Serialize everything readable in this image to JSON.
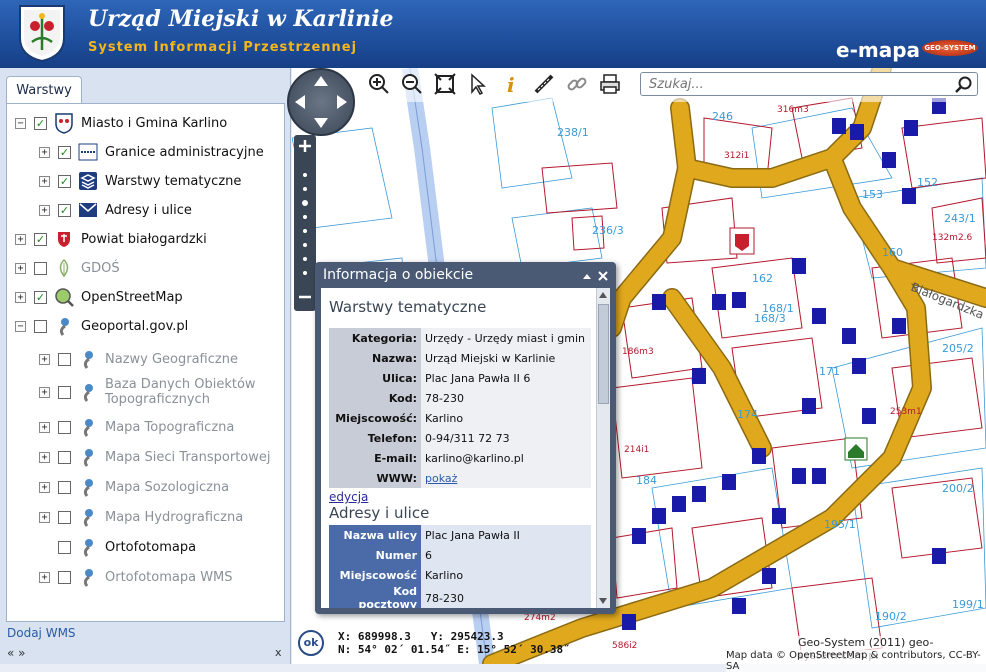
{
  "header": {
    "title": "Urząd Miejski w Karlinie",
    "subtitle": "System Informacji Przestrzennej",
    "brand": "e-mapa",
    "brand_badge": "GEO-SYSTEM"
  },
  "colors": {
    "header": "#1e4e9c",
    "accent": "#f4b61a",
    "road": "#d9a21e",
    "parcel": "#b4182c"
  },
  "left": {
    "tab": "Warstwy",
    "add_wms": "Dodaj WMS",
    "arrows": "«  »",
    "close": "x"
  },
  "layers": [
    {
      "label": "Miasto i Gmina Karlino",
      "checked": true,
      "icon": "crest-icon",
      "grey": false
    },
    {
      "label": "Granice administracyjne",
      "checked": true,
      "icon": "boundary-icon",
      "grey": false
    },
    {
      "label": "Warstwy tematyczne",
      "checked": true,
      "icon": "layers-icon",
      "grey": false
    },
    {
      "label": "Adresy i ulice",
      "checked": true,
      "icon": "envelope-icon",
      "grey": false
    },
    {
      "label": "Powiat białogardzki",
      "checked": true,
      "icon": "county-crest-icon",
      "grey": false
    },
    {
      "label": "GDOŚ",
      "checked": false,
      "icon": "leaf-icon",
      "grey": true
    },
    {
      "label": "OpenStreetMap",
      "checked": true,
      "icon": "magnifier-map-icon",
      "grey": false
    },
    {
      "label": "Geoportal.gov.pl",
      "checked": false,
      "icon": "geoportal-icon",
      "grey": false
    },
    {
      "label": "Nazwy Geograficzne",
      "checked": false,
      "icon": "geoportal-icon",
      "grey": true
    },
    {
      "label": "Baza Danych Obiektów",
      "label2": "Topograficznych",
      "checked": false,
      "icon": "geoportal-icon",
      "grey": true
    },
    {
      "label": "Mapa Topograficzna",
      "checked": false,
      "icon": "geoportal-icon",
      "grey": true
    },
    {
      "label": "Mapa Sieci Transportowej",
      "checked": false,
      "icon": "geoportal-icon",
      "grey": true
    },
    {
      "label": "Mapa Sozologiczna",
      "checked": false,
      "icon": "geoportal-icon",
      "grey": true
    },
    {
      "label": "Mapa Hydrograficzna",
      "checked": false,
      "icon": "geoportal-icon",
      "grey": true
    },
    {
      "label": "Ortofotomapa",
      "checked": false,
      "icon": "geoportal-icon",
      "grey": false
    },
    {
      "label": "Ortofotomapa WMS",
      "checked": false,
      "icon": "geoportal-icon",
      "grey": true
    }
  ],
  "search": {
    "placeholder": "Szukaj..."
  },
  "popup": {
    "title": "Informacja o obiekcie",
    "section1": "Warstwy tematyczne",
    "rows1": [
      {
        "k": "Kategoria:",
        "v": "Urzędy - Urzędy miast i gmin"
      },
      {
        "k": "Nazwa:",
        "v": "Urząd Miejski w Karlinie"
      },
      {
        "k": "Ulica:",
        "v": "Plac Jana Pawła II 6"
      },
      {
        "k": "Kod:",
        "v": "78-230"
      },
      {
        "k": "Miejscowość:",
        "v": "Karlino"
      },
      {
        "k": "Telefon:",
        "v": "0-94/311 72 73"
      },
      {
        "k": "E-mail:",
        "v": "karlino@karlino.pl"
      },
      {
        "k": "WWW:",
        "v": "pokaż"
      }
    ],
    "edit": "edycja",
    "section2": "Adresy i ulice",
    "rows2": [
      {
        "k": "Nazwa ulicy",
        "v": "Plac Jana Pawła II"
      },
      {
        "k": "Numer",
        "v": "6"
      },
      {
        "k": "Miejscowość",
        "v": "Karlino"
      },
      {
        "k": "Kod pocztowy",
        "v": "78-230"
      }
    ]
  },
  "status": {
    "ok": "ok",
    "x": "X: 689998.3",
    "y": "Y: 295423.3",
    "n": "N: 54° 02´ 01.54˝",
    "e": "E: 15° 52´ 30.38˝"
  },
  "credits": {
    "geo": "Geo-System (2011) geo-system.com.pl",
    "osm": "Map data © OpenStreetMap & contributors, CC-BY-SA"
  },
  "map_labels": [
    {
      "t": "238/1",
      "c": "b"
    },
    {
      "t": "246",
      "c": "b"
    },
    {
      "t": "312i1",
      "c": "r"
    },
    {
      "t": "316m3",
      "c": "r"
    },
    {
      "t": "153",
      "c": "b"
    },
    {
      "t": "152",
      "c": "b"
    },
    {
      "t": "160",
      "c": "b"
    },
    {
      "t": "162",
      "c": "b"
    },
    {
      "t": "168/1",
      "c": "b"
    },
    {
      "t": "168/3",
      "c": "b"
    },
    {
      "t": "171",
      "c": "b"
    },
    {
      "t": "174",
      "c": "b"
    },
    {
      "t": "184",
      "c": "b"
    },
    {
      "t": "195/1",
      "c": "b"
    },
    {
      "t": "190/2",
      "c": "b"
    },
    {
      "t": "200/2",
      "c": "b"
    },
    {
      "t": "205/2",
      "c": "b"
    },
    {
      "t": "199/1",
      "c": "b"
    },
    {
      "t": "236/3",
      "c": "b"
    },
    {
      "t": "243/1",
      "c": "b"
    },
    {
      "t": "132m2.6",
      "c": "r"
    },
    {
      "t": "253m1",
      "c": "r"
    },
    {
      "t": "186m3",
      "c": "r"
    },
    {
      "t": "214i1",
      "c": "r"
    },
    {
      "t": "274m2",
      "c": "r"
    },
    {
      "t": "586i2",
      "c": "r"
    },
    {
      "t": "Białogardzka",
      "c": "road"
    }
  ]
}
